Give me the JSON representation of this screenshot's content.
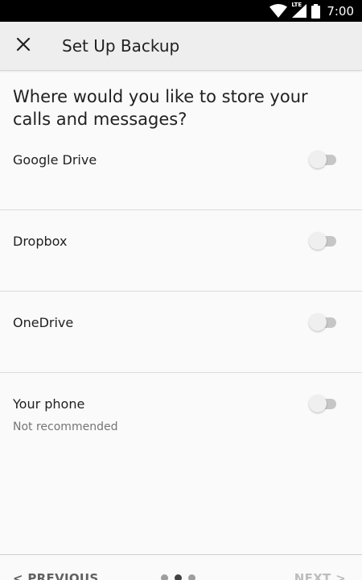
{
  "status_bar": {
    "time": "7:00",
    "network_label": "LTE",
    "icons": [
      "wifi-icon",
      "cellular-signal-icon",
      "battery-icon"
    ]
  },
  "header": {
    "title": "Set Up Backup",
    "close_icon": "close-icon"
  },
  "question": "Where would you like to store your calls and messages?",
  "options": [
    {
      "label": "Google Drive",
      "enabled": false
    },
    {
      "label": "Dropbox",
      "enabled": false
    },
    {
      "label": "OneDrive",
      "enabled": false
    },
    {
      "label": "Your phone",
      "sublabel": "Not recommended",
      "enabled": false
    }
  ],
  "footer": {
    "previous_label": "< PREVIOUS",
    "next_label": "NEXT >",
    "pages": 3,
    "current_page": 2
  },
  "colors": {
    "status_bar": "#000000",
    "app_bar": "#eeeeee",
    "background": "#fafafa",
    "switch_track_off": "#c6c6c6",
    "switch_thumb_off": "#efefef",
    "next_disabled": "#bdbdbd"
  }
}
